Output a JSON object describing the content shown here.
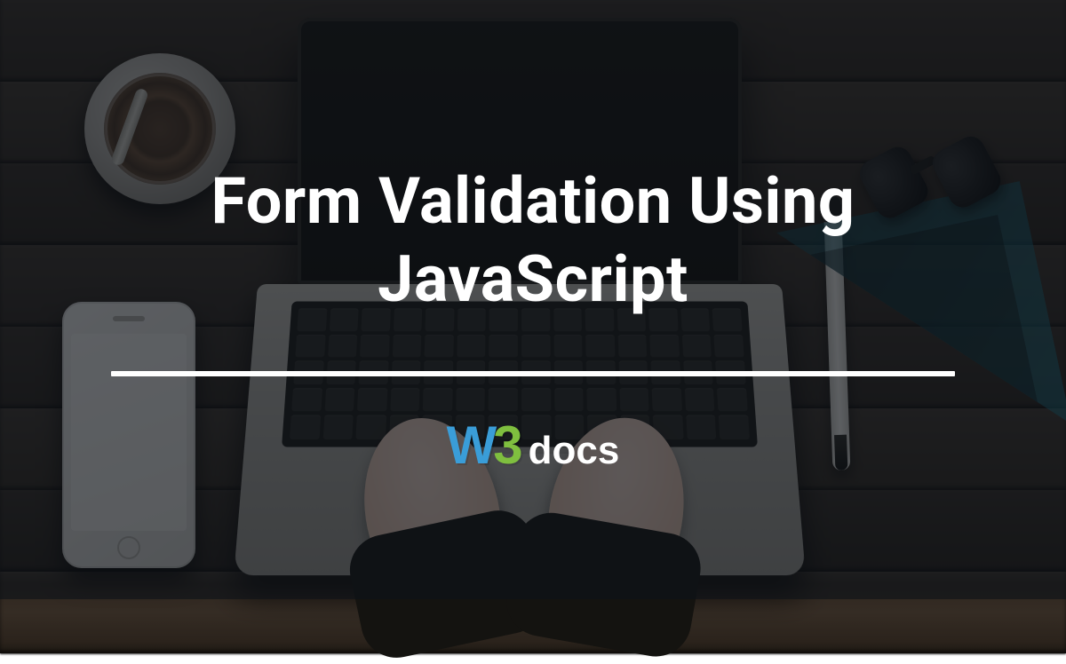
{
  "hero": {
    "title": "Form Validation Using JavaScript"
  },
  "brand": {
    "w": "W",
    "three": "3",
    "docs": "docs"
  },
  "colors": {
    "overlay": "rgba(14,18,24,0.66)",
    "logo_blue": "#3a9dd8",
    "logo_green": "#7fbf3f",
    "text": "#ffffff"
  }
}
